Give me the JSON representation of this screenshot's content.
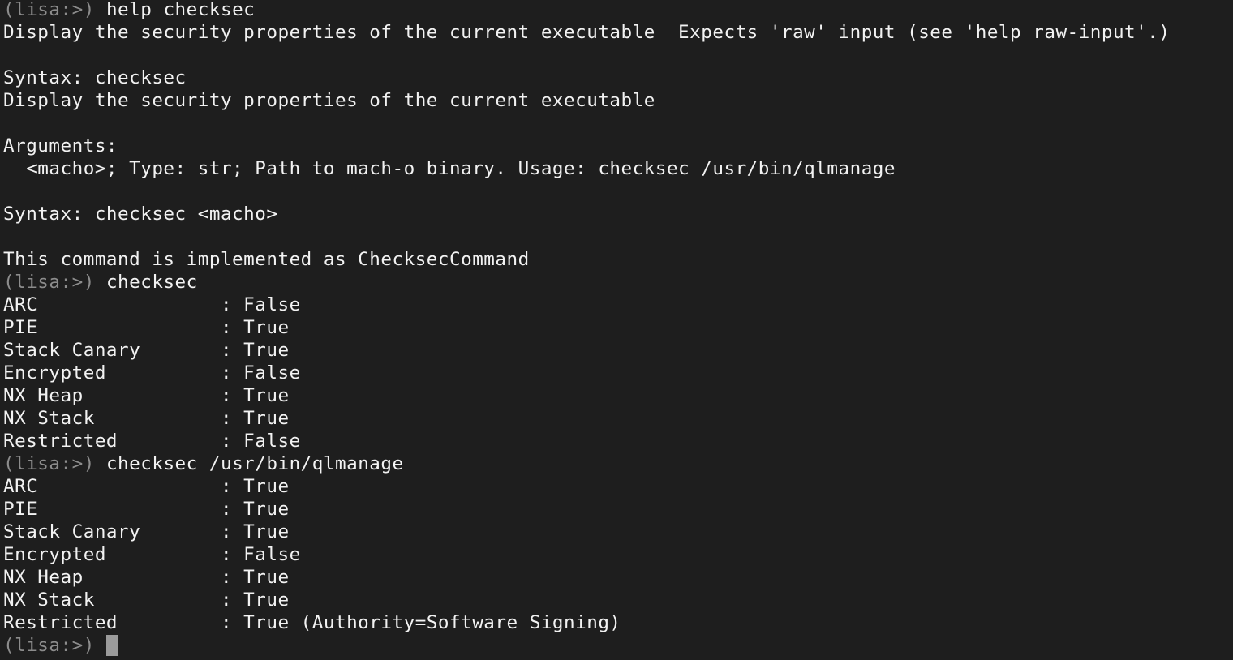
{
  "terminal": {
    "prompt": "(lisa:>) ",
    "lines": [
      {
        "type": "cmd",
        "text": "help checksec"
      },
      {
        "type": "out",
        "text": "Display the security properties of the current executable  Expects 'raw' input (see 'help raw-input'.)"
      },
      {
        "type": "out",
        "text": ""
      },
      {
        "type": "out",
        "text": "Syntax: checksec"
      },
      {
        "type": "out",
        "text": "Display the security properties of the current executable"
      },
      {
        "type": "out",
        "text": ""
      },
      {
        "type": "out",
        "text": "Arguments:"
      },
      {
        "type": "out",
        "text": "  <macho>; Type: str; Path to mach-o binary. Usage: checksec /usr/bin/qlmanage"
      },
      {
        "type": "out",
        "text": ""
      },
      {
        "type": "out",
        "text": "Syntax: checksec <macho>"
      },
      {
        "type": "out",
        "text": ""
      },
      {
        "type": "out",
        "text": "This command is implemented as ChecksecCommand"
      },
      {
        "type": "cmd",
        "text": "checksec"
      },
      {
        "type": "out",
        "text": "ARC                : False"
      },
      {
        "type": "out",
        "text": "PIE                : True"
      },
      {
        "type": "out",
        "text": "Stack Canary       : True"
      },
      {
        "type": "out",
        "text": "Encrypted          : False"
      },
      {
        "type": "out",
        "text": "NX Heap            : True"
      },
      {
        "type": "out",
        "text": "NX Stack           : True"
      },
      {
        "type": "out",
        "text": "Restricted         : False"
      },
      {
        "type": "cmd",
        "text": "checksec /usr/bin/qlmanage"
      },
      {
        "type": "out",
        "text": "ARC                : True"
      },
      {
        "type": "out",
        "text": "PIE                : True"
      },
      {
        "type": "out",
        "text": "Stack Canary       : True"
      },
      {
        "type": "out",
        "text": "Encrypted          : False"
      },
      {
        "type": "out",
        "text": "NX Heap            : True"
      },
      {
        "type": "out",
        "text": "NX Stack           : True"
      },
      {
        "type": "out",
        "text": "Restricted         : True (Authority=Software Signing)"
      },
      {
        "type": "input",
        "text": ""
      }
    ]
  },
  "colors": {
    "background": "#1e1e1e",
    "text": "#f2f2f2",
    "prompt": "#8c8c8c",
    "cursor": "#9b9b9b"
  }
}
